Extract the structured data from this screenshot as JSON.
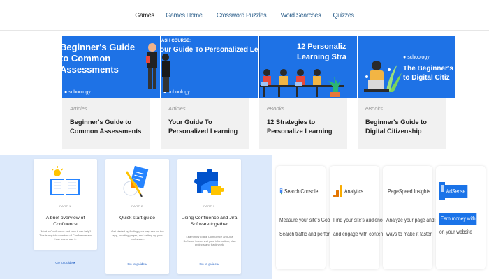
{
  "nav": {
    "items": [
      {
        "label": "Games",
        "active": true
      },
      {
        "label": "Games Home",
        "active": false
      },
      {
        "label": "Crossword Puzzles",
        "active": false
      },
      {
        "label": "Word Searches",
        "active": false
      },
      {
        "label": "Quizzes",
        "active": false
      }
    ]
  },
  "articles": [
    {
      "banner_text": "Beginner's Guide\nto Common\nAssessments",
      "banner_logo": "schoology",
      "category": "Articles",
      "title": "Beginner's Guide to Common Assessments"
    },
    {
      "banner_kicker": "ASH COURSE:",
      "banner_text": "our Guide To Personalized Le",
      "banner_logo": "schoology",
      "category": "Articles",
      "title": "Your Guide To Personalized Learning"
    },
    {
      "banner_text": "12 Personaliz\nLearning Stra",
      "category": "eBooks",
      "title": "12 Strategies to Personalize Learning"
    },
    {
      "banner_logo": "schoology",
      "banner_text": "The Beginner's\nto Digital Citiz",
      "category": "eBooks",
      "title": "Beginner's Guide to Digital Citizenship"
    }
  ],
  "confluence_cards": [
    {
      "icon": "book-lightbulb-icon",
      "tag": "PART 1",
      "title": "A brief overview of Confluence",
      "description": "What is Confluence and how it can help? This is a quick overview of Confluence and how teams use it.",
      "link": "Go to guide ▸"
    },
    {
      "icon": "clipboard-pencil-icon",
      "tag": "PART 2",
      "title": "Quick start guide",
      "description": "Get started by finding your way around the app, creating pages, and setting up your workspace.",
      "link": "Go to guide ▸"
    },
    {
      "icon": "puzzle-icon",
      "tag": "PART 3",
      "title": "Using Confluence and Jira Software together",
      "description": "Learn how to link Confluence and Jira Software to connect your information, plan projects and track work.",
      "link": "Go to guide ▸"
    }
  ],
  "tools": [
    {
      "name": "Search Console",
      "icon": "search-console-icon",
      "color": "#4285f4",
      "desc_lines": [
        "Measure your site's Google",
        "Search traffic and performance"
      ]
    },
    {
      "name": "Analytics",
      "icon": "analytics-icon",
      "color": "#f9ab00",
      "desc_lines": [
        "Find your site's audience",
        "and engage with content"
      ]
    },
    {
      "name": "PageSpeed Insights",
      "icon": "pagespeed-icon",
      "color": "#4285f4",
      "desc_lines": [
        "Analyze your page and suggest",
        "ways to make it faster"
      ]
    },
    {
      "name": "AdSense",
      "icon": "adsense-icon",
      "color": "#1a73e8",
      "desc_lines": [
        "Earn money with ads",
        "on your website"
      ]
    }
  ],
  "colors": {
    "banner_blue": "#1e72e6",
    "panel_blue": "#dce9fb",
    "link_blue": "#2b5e8a"
  }
}
